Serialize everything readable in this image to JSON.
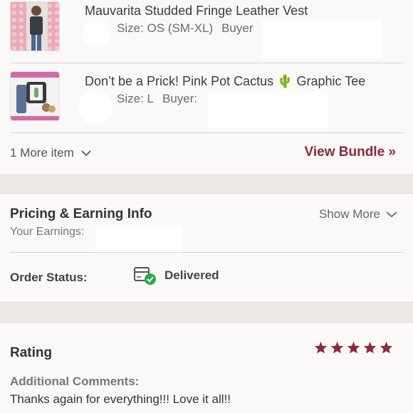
{
  "items": [
    {
      "title": "Mauvarita Studded Fringe Leather Vest",
      "size_label": "Size: OS (SM-XL)",
      "buyer_label": "Buyer"
    },
    {
      "title": "Don’t be a Prick! Pink Pot Cactus 🌵 Graphic Tee",
      "size_label": "Size: L",
      "buyer_label": "Buyer:"
    }
  ],
  "more_items": "1 More item",
  "view_bundle": "View Bundle »",
  "pricing": {
    "title": "Pricing & Earning Info",
    "show_more": "Show More",
    "earnings_label": "Your Earnings:"
  },
  "order_status": {
    "label": "Order Status:",
    "value": "Delivered"
  },
  "rating": {
    "title": "Rating",
    "stars": 5,
    "comments_label": "Additional Comments:",
    "comments": "Thanks again for everything!!! Love it all!!"
  },
  "colors": {
    "accent": "#8a2a3a",
    "check": "#2aa84a"
  }
}
